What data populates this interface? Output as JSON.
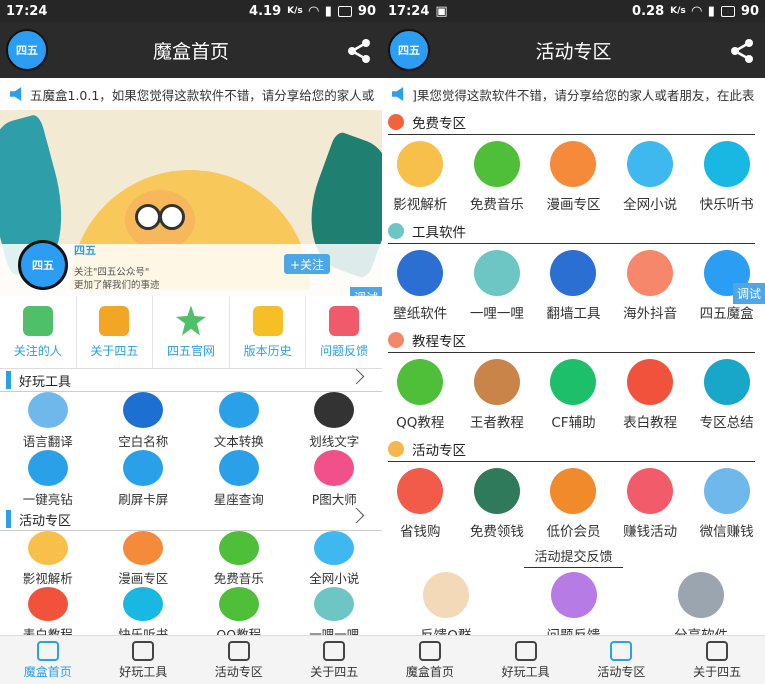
{
  "left": {
    "status": {
      "time": "17:24",
      "speed": "4.19",
      "speed_unit": "K/s",
      "battery": "90"
    },
    "title": "魔盒首页",
    "logo_text": "四五",
    "marquee": "五魔盒1.0.1，如果您觉得这款软件不错，请分享给您的家人或",
    "banner": {
      "name": "四五",
      "sub1": "关注\"四五公众号\"",
      "sub2": "更加了解我们的事迹",
      "follow": "+关注",
      "debug": "调试"
    },
    "quick": [
      {
        "label": "关注的人",
        "icon": "sliders-icon",
        "color": "#4fbf6a"
      },
      {
        "label": "关于四五",
        "icon": "wallet-icon",
        "color": "#f2a623"
      },
      {
        "label": "四五官网",
        "icon": "star-icon",
        "color": "#4fbf6a"
      },
      {
        "label": "版本历史",
        "icon": "folder-icon",
        "color": "#f6bf26"
      },
      {
        "label": "问题反馈",
        "icon": "list-icon",
        "color": "#f05a6b"
      }
    ],
    "section1": "好玩工具",
    "tools": [
      {
        "label": "语言翻译",
        "icon": "chat-icon",
        "color": "#6fb8ec"
      },
      {
        "label": "空白名称",
        "icon": "eye-icon",
        "color": "#1d6fd1"
      },
      {
        "label": "文本转换",
        "icon": "edit-icon",
        "color": "#2aa0e8"
      },
      {
        "label": "划线文字",
        "icon": "note-icon",
        "color": "#333333"
      },
      {
        "label": "一键亮钻",
        "icon": "card-icon",
        "color": "#2aa0e8"
      },
      {
        "label": "刷屏卡屏",
        "icon": "scroll-icon",
        "color": "#2aa0e8"
      },
      {
        "label": "星座查询",
        "icon": "book-icon",
        "color": "#2aa0e8"
      },
      {
        "label": "P图大师",
        "icon": "bubble-icon",
        "color": "#f2508a"
      }
    ],
    "section2": "活动专区",
    "activities": [
      {
        "label": "影视解析",
        "icon": "tv-icon",
        "color": "#f6c04a"
      },
      {
        "label": "漫画专区",
        "icon": "wand-icon",
        "color": "#f58a3a"
      },
      {
        "label": "免费音乐",
        "icon": "music-icon",
        "color": "#4fbf3a"
      },
      {
        "label": "全网小说",
        "icon": "face-icon",
        "color": "#3fb7ef"
      },
      {
        "label": "表白教程",
        "icon": "dumbbell-icon",
        "color": "#f0523b"
      },
      {
        "label": "快乐听书",
        "icon": "t-icon",
        "color": "#18b8e3"
      },
      {
        "label": "QQ教程",
        "icon": "qq-icon",
        "color": "#4fbf3a"
      },
      {
        "label": "一哩一哩",
        "icon": "cube-icon",
        "color": "#6ec6c4"
      }
    ],
    "nav": [
      "魔盒首页",
      "好玩工具",
      "活动专区",
      "关于四五"
    ]
  },
  "right": {
    "status": {
      "time": "17:24",
      "speed": "0.28",
      "speed_unit": "K/s",
      "battery": "90"
    },
    "title": "活动专区",
    "logo_text": "四五",
    "marquee": "]果您觉得这款软件不错，请分享给您的家人或者朋友，在此表",
    "debug": "调试",
    "sections": [
      {
        "title": "免费专区",
        "color": "#f2623b",
        "items": [
          {
            "label": "影视解析",
            "icon": "tv-icon",
            "color": "#f6c04a"
          },
          {
            "label": "免费音乐",
            "icon": "music-icon",
            "color": "#4fbf3a"
          },
          {
            "label": "漫画专区",
            "icon": "wand-icon",
            "color": "#f58a3a"
          },
          {
            "label": "全网小说",
            "icon": "face-icon",
            "color": "#3fb7ef"
          },
          {
            "label": "快乐听书",
            "icon": "t-icon",
            "color": "#18b8e3"
          }
        ]
      },
      {
        "title": "工具软件",
        "color": "#6ec6c4",
        "items": [
          {
            "label": "壁纸软件",
            "icon": "leaf-icon",
            "color": "#2a6fd1"
          },
          {
            "label": "一哩一哩",
            "icon": "cube-icon",
            "color": "#6ec6c4"
          },
          {
            "label": "翻墙工具",
            "icon": "rocket-icon",
            "color": "#2a6fd1"
          },
          {
            "label": "海外抖音",
            "icon": "pie-icon",
            "color": "#f6876a"
          },
          {
            "label": "四五魔盒",
            "icon": "logo-icon",
            "color": "#2b9df2"
          }
        ]
      },
      {
        "title": "教程专区",
        "color": "#f2876a",
        "items": [
          {
            "label": "QQ教程",
            "icon": "qq-icon",
            "color": "#4fbf3a"
          },
          {
            "label": "王者教程",
            "icon": "hero-icon",
            "color": "#c9844a"
          },
          {
            "label": "CF辅助",
            "icon": "pencil-icon",
            "color": "#1ebf6a"
          },
          {
            "label": "表白教程",
            "icon": "dumbbell-icon",
            "color": "#f0523b"
          },
          {
            "label": "专区总结",
            "icon": "chat-icon",
            "color": "#18a6c9"
          }
        ]
      },
      {
        "title": "活动专区",
        "color": "#f6b64a",
        "items": [
          {
            "label": "省钱购",
            "icon": "gift-icon",
            "color": "#f25b4a"
          },
          {
            "label": "免费领钱",
            "icon": "moneybag-icon",
            "color": "#2e7a5a"
          },
          {
            "label": "低价会员",
            "icon": "fire-icon",
            "color": "#f08a2a"
          },
          {
            "label": "赚钱活动",
            "icon": "thumb-icon",
            "color": "#f25b6a"
          },
          {
            "label": "微信赚钱",
            "icon": "chat-icon",
            "color": "#6fb8ec"
          }
        ]
      }
    ],
    "feedback_title": "活动提交反馈",
    "feedback": [
      {
        "label": "反馈Q群",
        "icon": "girl-icon",
        "color": "#f3d9b8"
      },
      {
        "label": "问题反馈",
        "icon": "message-icon",
        "color": "#b77be6"
      },
      {
        "label": "分享软件",
        "icon": "share-icon",
        "color": "#9aa5b0"
      }
    ],
    "nav": [
      "魔盒首页",
      "好玩工具",
      "活动专区",
      "关于四五"
    ]
  }
}
